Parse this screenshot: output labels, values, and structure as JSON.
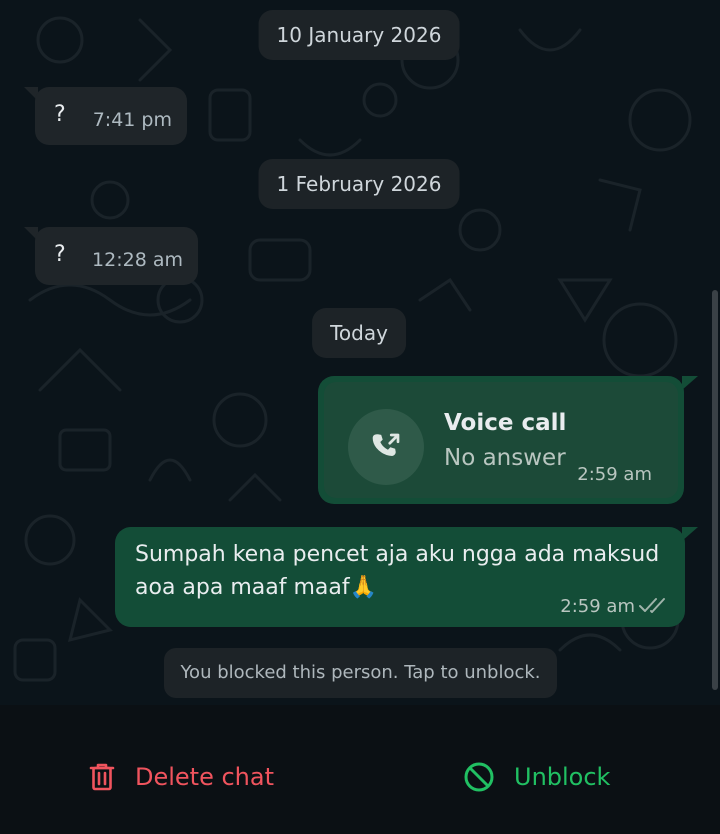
{
  "dates": [
    "10 January 2026",
    "1 February 2026",
    "Today"
  ],
  "incoming_messages": [
    {
      "text": "?",
      "time": "7:41 pm"
    },
    {
      "text": "?",
      "time": "12:28 am"
    }
  ],
  "voice_call": {
    "title": "Voice call",
    "status": "No answer",
    "time": "2:59 am",
    "icon": "outgoing-call-icon"
  },
  "outgoing_message": {
    "text": "Sumpah kena pencet aja aku ngga ada maksud aoa apa maaf maaf🙏",
    "time": "2:59 am",
    "receipt_icon": "double-check-icon"
  },
  "blocked_notice": "You blocked this person. Tap to unblock.",
  "actions": {
    "delete_label": "Delete chat",
    "unblock_label": "Unblock"
  },
  "colors": {
    "outgoing_bubble": "#134d37",
    "incoming_bubble": "#1f2529",
    "delete": "#f0545e",
    "unblock": "#21c063"
  }
}
